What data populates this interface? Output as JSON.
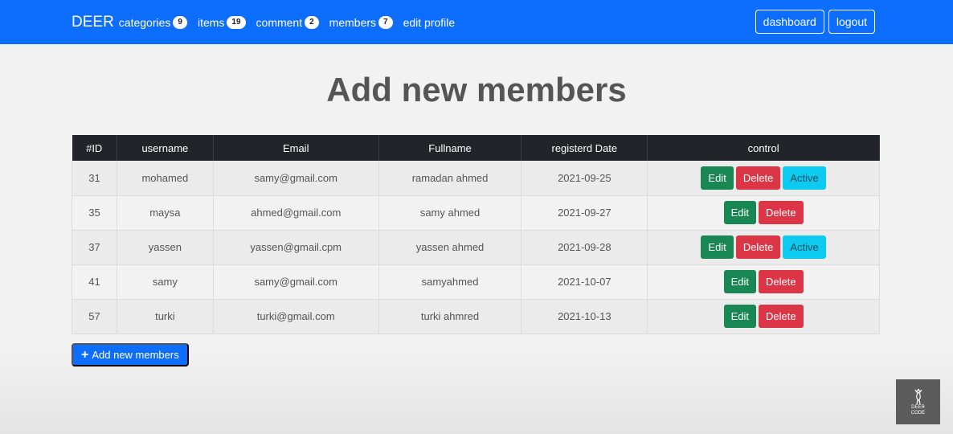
{
  "navbar": {
    "brand": "DEER",
    "items": [
      {
        "label": "categories",
        "count": "9"
      },
      {
        "label": "items",
        "count": "19"
      },
      {
        "label": "comment",
        "count": "2"
      },
      {
        "label": "members",
        "count": "7"
      }
    ],
    "edit_profile": "edit profile",
    "dashboard": "dashboard",
    "logout": "logout",
    "background_color": "#0d6efd"
  },
  "page": {
    "title": "Add new members"
  },
  "table": {
    "headers": [
      "#ID",
      "username",
      "Email",
      "Fullname",
      "registerd Date",
      "control"
    ],
    "rows": [
      {
        "id": "31",
        "username": "mohamed",
        "email": "samy@gmail.com",
        "fullname": "ramadan ahmed",
        "date": "2021-09-25",
        "active": true
      },
      {
        "id": "35",
        "username": "maysa",
        "email": "ahmed@gmail.com",
        "fullname": "samy ahmed",
        "date": "2021-09-27",
        "active": false
      },
      {
        "id": "37",
        "username": "yassen",
        "email": "yassen@gmail.cpm",
        "fullname": "yassen ahmed",
        "date": "2021-09-28",
        "active": true
      },
      {
        "id": "41",
        "username": "samy",
        "email": "samy@gmail.com",
        "fullname": "samyahmed",
        "date": "2021-10-07",
        "active": false
      },
      {
        "id": "57",
        "username": "turki",
        "email": "turki@gmail.com",
        "fullname": "turki ahmred",
        "date": "2021-10-13",
        "active": false
      }
    ],
    "controls": {
      "edit": "Edit",
      "delete": "Delete",
      "active": "Active"
    }
  },
  "add_button": {
    "label": "Add new members",
    "icon": "plus-icon"
  },
  "watermark": {
    "line1": "DEER",
    "line2": "CODE",
    "icon": "deer-icon"
  }
}
